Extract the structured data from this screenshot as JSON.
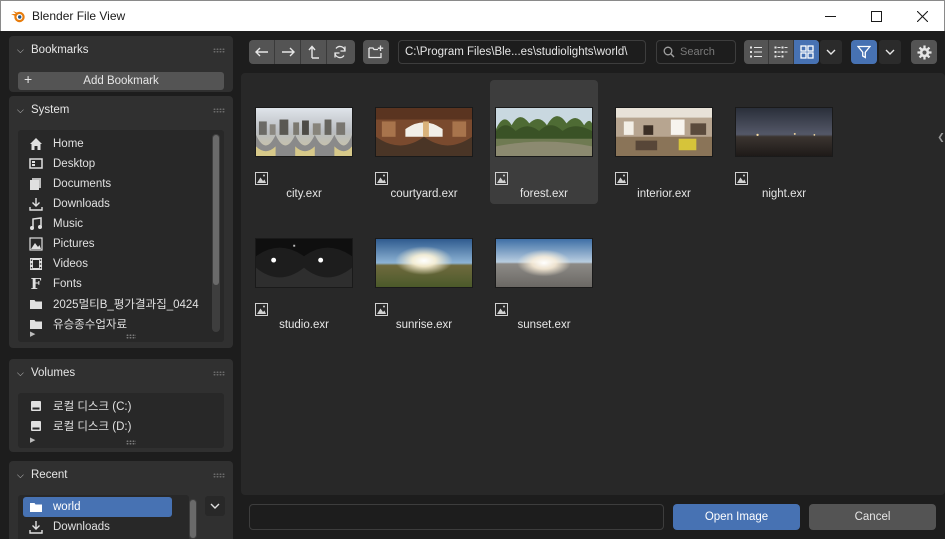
{
  "window": {
    "title": "Blender File View",
    "minimize_icon": "minimize-icon",
    "maximize_icon": "maximize-icon",
    "close_icon": "close-icon"
  },
  "sidebar": {
    "bookmarks": {
      "title": "Bookmarks",
      "add_label": "Add Bookmark"
    },
    "system": {
      "title": "System",
      "items": [
        {
          "label": "Home",
          "icon": "home-icon"
        },
        {
          "label": "Desktop",
          "icon": "desktop-icon"
        },
        {
          "label": "Documents",
          "icon": "documents-icon"
        },
        {
          "label": "Downloads",
          "icon": "download-icon"
        },
        {
          "label": "Music",
          "icon": "music-icon"
        },
        {
          "label": "Pictures",
          "icon": "picture-icon"
        },
        {
          "label": "Videos",
          "icon": "video-icon"
        },
        {
          "label": "Fonts",
          "icon": "font-icon"
        },
        {
          "label": "2025멀티B_평가결과집_0424",
          "icon": "folder-icon"
        },
        {
          "label": "유승종수업자료",
          "icon": "folder-icon"
        }
      ]
    },
    "volumes": {
      "title": "Volumes",
      "items": [
        {
          "label": "로컬 디스크 (C:)",
          "icon": "disk-icon"
        },
        {
          "label": "로컬 디스크 (D:)",
          "icon": "disk-icon"
        }
      ]
    },
    "recent": {
      "title": "Recent",
      "items": [
        {
          "label": "world",
          "icon": "folder-icon",
          "selected": true
        },
        {
          "label": "Downloads",
          "icon": "download-icon",
          "selected": false
        }
      ]
    }
  },
  "toolbar": {
    "path": "C:\\Program Files\\Ble...es\\studiolights\\world\\",
    "search_placeholder": "Search",
    "display_mode": "thumbnails",
    "filter_enabled": true
  },
  "files": [
    {
      "name": "city.exr",
      "highlighted": false
    },
    {
      "name": "courtyard.exr",
      "highlighted": false
    },
    {
      "name": "forest.exr",
      "highlighted": true
    },
    {
      "name": "interior.exr",
      "highlighted": false
    },
    {
      "name": "night.exr",
      "highlighted": false
    },
    {
      "name": "studio.exr",
      "highlighted": false
    },
    {
      "name": "sunrise.exr",
      "highlighted": false
    },
    {
      "name": "sunset.exr",
      "highlighted": false
    }
  ],
  "footer": {
    "filename_value": "",
    "open_label": "Open Image",
    "cancel_label": "Cancel"
  },
  "colors": {
    "accent": "#4772b3",
    "panel": "#303030",
    "background": "#1d1d1d",
    "button": "#545454"
  }
}
